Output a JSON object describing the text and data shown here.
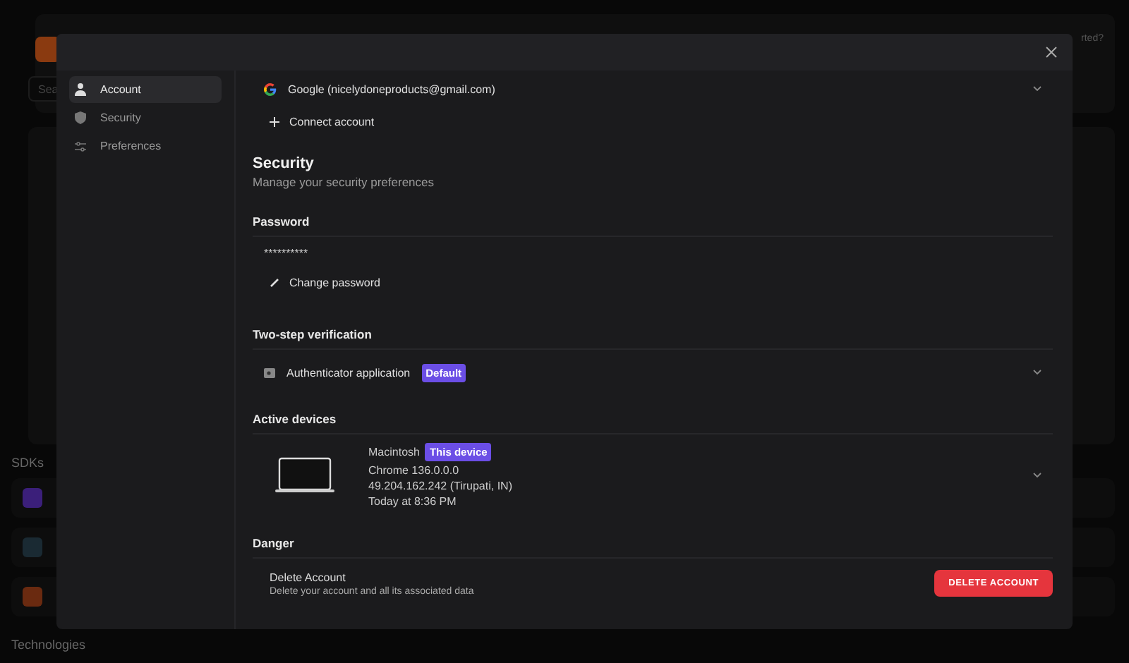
{
  "background": {
    "header_text": "rted?",
    "search": {
      "placeholder": "Sea"
    },
    "sections": [
      {
        "title": "SDKs"
      },
      {
        "title": "Technologies"
      }
    ]
  },
  "modal": {
    "sidebar": {
      "items": [
        {
          "label": "Account",
          "selected": true
        },
        {
          "label": "Security",
          "selected": false
        },
        {
          "label": "Preferences",
          "selected": false
        }
      ]
    },
    "linked_accounts": [
      {
        "label": "Google (nicelydoneproducts@gmail.com)",
        "expanded": false
      }
    ],
    "connect_button": "Connect account",
    "title": "Security",
    "subtitle": "Manage your security preferences",
    "password": {
      "heading": "Password",
      "value": "**********",
      "change_button": "Change password"
    },
    "two_step": {
      "heading": "Two-step verification",
      "methods": [
        {
          "label": "Authenticator application",
          "badge": "Default",
          "expanded": false
        }
      ]
    },
    "devices": {
      "heading": "Active devices",
      "items": [
        {
          "name": "Macintosh",
          "badge": "This device",
          "browser": "Chrome 136.0.0.0",
          "ip": "49.204.162.242 (Tirupati, IN)",
          "last_seen": "Today at 8:36 PM",
          "expanded": false
        }
      ]
    },
    "danger": {
      "heading": "Danger",
      "title": "Delete Account",
      "description": "Delete your account and all its associated data",
      "button": "DELETE ACCOUNT"
    }
  }
}
